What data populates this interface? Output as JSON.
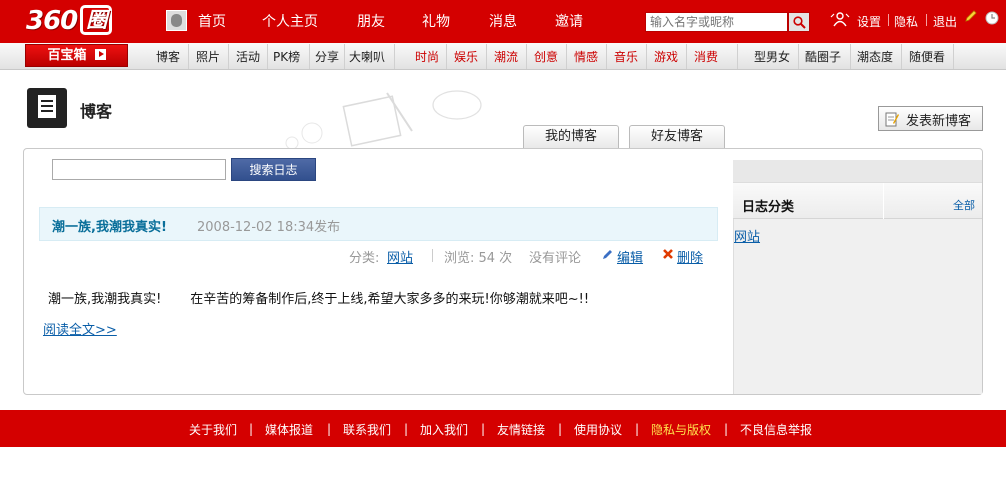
{
  "header": {
    "logo_text": "360",
    "logo_box": "圈",
    "nav": [
      "首页",
      "个人主页",
      "朋友",
      "礼物",
      "消息",
      "邀请"
    ],
    "search_placeholder": "输入名字或昵称",
    "links": [
      "设置",
      "隐私",
      "退出"
    ],
    "icons": [
      "people-icon",
      "search-icon",
      "pencil-icon",
      "clock-icon"
    ]
  },
  "subnav": {
    "treasure_label": "百宝箱",
    "items": [
      "博客",
      "照片",
      "活动",
      "PK榜",
      "分享",
      "大喇叭"
    ],
    "red_items": [
      "时尚",
      "娱乐",
      "潮流",
      "创意",
      "情感",
      "音乐",
      "游戏",
      "消费"
    ],
    "right_items": [
      "型男女",
      "酷圈子",
      "潮态度",
      "随便看"
    ]
  },
  "page": {
    "title": "博客",
    "publish_label": "发表新博客",
    "tabs": [
      "我的博客",
      "好友博客"
    ],
    "search_button": "搜索日志"
  },
  "sidebar": {
    "title": "日志分类",
    "all_label": "全部",
    "categories": [
      "网站"
    ]
  },
  "post": {
    "title": "潮一族,我潮我真实!",
    "date": "2008-12-02 18:34发布",
    "category_label": "分类:",
    "category": "网站",
    "views": "浏览: 54 次",
    "comments": "没有评论",
    "edit_label": "编辑",
    "delete_label": "删除",
    "body": "潮一族,我潮我真实!       在辛苦的筹备制作后,终于上线,希望大家多多的来玩!你够潮就来吧~!!",
    "read_more": "阅读全文>>"
  },
  "footer": {
    "items": [
      "关于我们",
      "媒体报道",
      "联系我们",
      "加入我们",
      "友情链接",
      "使用协议",
      "隐私与版权",
      "不良信息举报"
    ],
    "highlight_color": "#ffe14d"
  },
  "colors": {
    "brand_red": "#d40000",
    "link_blue": "#0a5ea8",
    "post_title": "#0a6f9a"
  }
}
